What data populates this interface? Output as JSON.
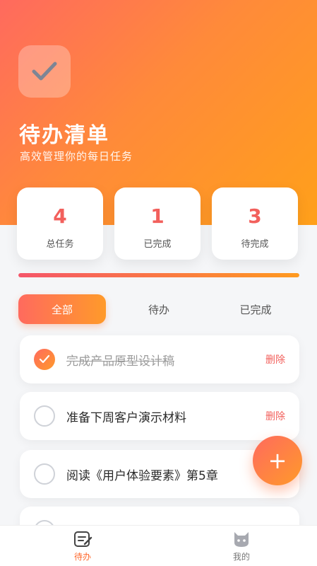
{
  "header": {
    "title": "待办清单",
    "subtitle": "高效管理你的每日任务",
    "app_icon": "checkmark-icon"
  },
  "stats": [
    {
      "value": "4",
      "label": "总任务"
    },
    {
      "value": "1",
      "label": "已完成"
    },
    {
      "value": "3",
      "label": "待完成"
    }
  ],
  "progress": {
    "fraction": 1.0
  },
  "filters": {
    "all": "全部",
    "pending": "待办",
    "completed": "已完成",
    "active": "all"
  },
  "tasks": [
    {
      "text": "完成产品原型设计稿",
      "done": true,
      "action": "删除"
    },
    {
      "text": "准备下周客户演示材料",
      "done": false,
      "action": "删除"
    },
    {
      "text": "阅读《用户体验要素》第5章",
      "done": false,
      "action": ""
    }
  ],
  "fab": {
    "label": "+"
  },
  "nav": {
    "todo": {
      "label": "待办",
      "icon": "todo-list-icon"
    },
    "mine": {
      "label": "我的",
      "icon": "cat-avatar-icon"
    }
  },
  "colors": {
    "accent": "#ff6a5e",
    "accent2": "#ffa01a"
  }
}
